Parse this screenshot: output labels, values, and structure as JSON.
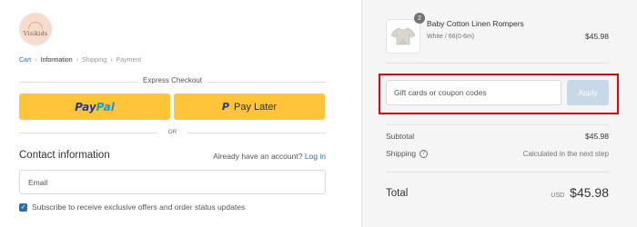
{
  "brand": {
    "logo_text": "Visikids"
  },
  "breadcrumb": {
    "items": [
      {
        "label": "Cart"
      },
      {
        "label": "Information"
      },
      {
        "label": "Shipping"
      },
      {
        "label": "Payment"
      }
    ],
    "separator": "›"
  },
  "express": {
    "heading": "Express Checkout",
    "paypal_part1": "Pay",
    "paypal_part2": "Pal",
    "paylater_icon": "P",
    "paylater_label": "Pay Later",
    "divider_label": "OR"
  },
  "contact": {
    "title": "Contact information",
    "account_prompt": "Already have an account?",
    "login_link": "Log in",
    "email_placeholder": "Email",
    "subscribe_label": "Subscribe to receive exclusive offers and order status updates"
  },
  "summary": {
    "product": {
      "quantity": "2",
      "name": "Baby Cotton Linen Rompers",
      "variant": "White / 66(0-6m)",
      "price": "$45.98"
    },
    "coupon_placeholder": "Gift cards or coupon codes",
    "apply_label": "Apply",
    "subtotal_label": "Subtotal",
    "subtotal_value": "$45.98",
    "shipping_label": "Shipping",
    "shipping_value": "Calculated in the next step",
    "total_label": "Total",
    "currency": "USD",
    "total_value": "$45.98"
  },
  "colors": {
    "paypal_yellow": "#ffc439",
    "link_blue": "#2b6fb3",
    "highlight_red": "#e3000f",
    "apply_disabled": "#c8d8e7"
  }
}
